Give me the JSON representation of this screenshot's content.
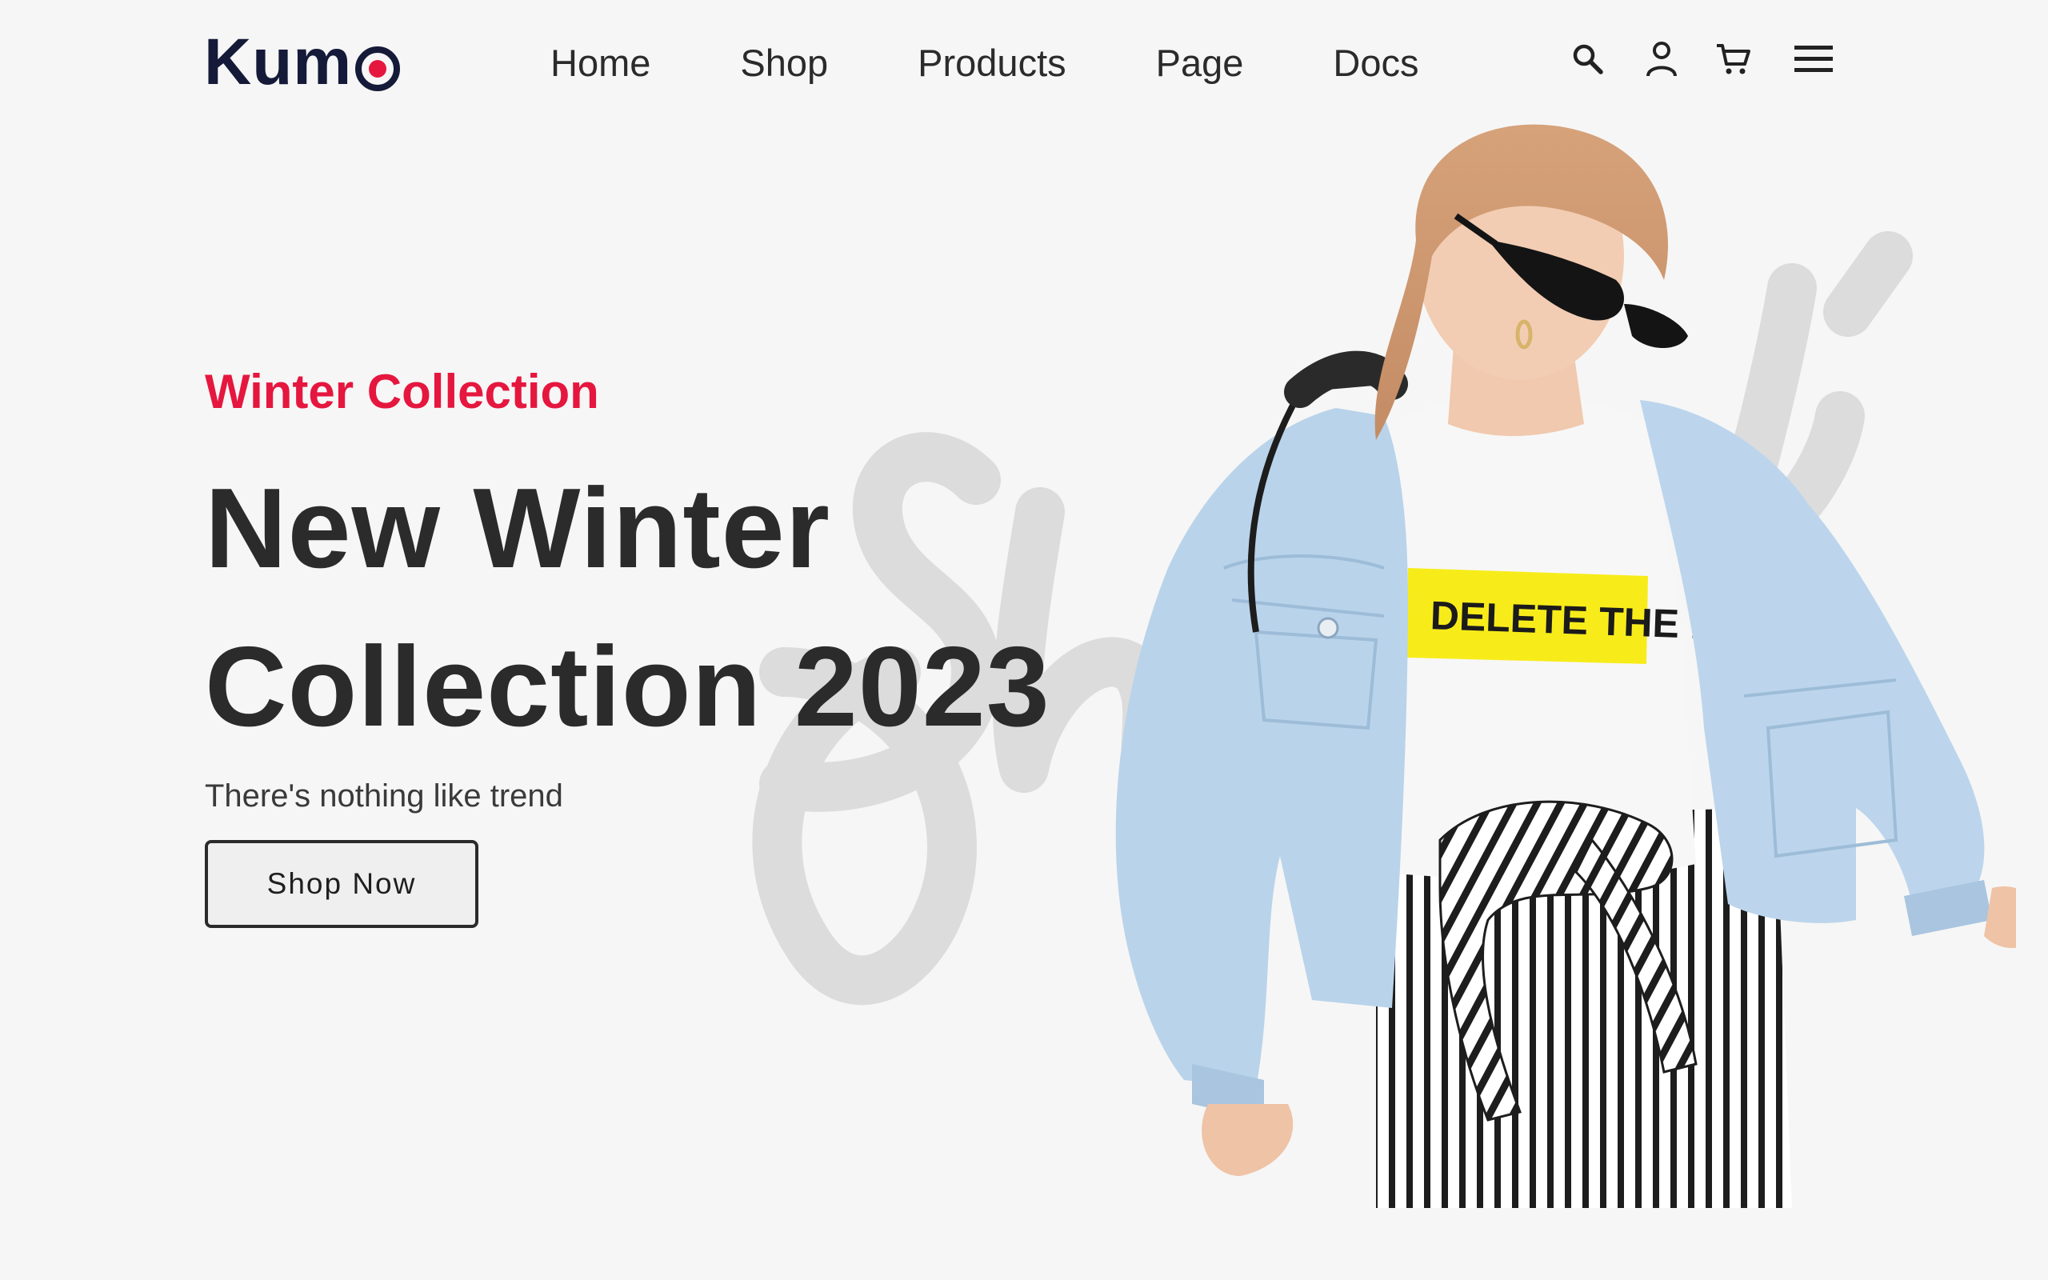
{
  "brand": {
    "logo_text": "Kum",
    "accent_color": "#e5173f",
    "dark_color": "#141a38"
  },
  "nav": {
    "items": [
      {
        "label": "Home"
      },
      {
        "label": "Shop"
      },
      {
        "label": "Products"
      },
      {
        "label": "Page"
      },
      {
        "label": "Docs"
      }
    ]
  },
  "header_icons": [
    "search-icon",
    "user-icon",
    "cart-icon",
    "menu-icon"
  ],
  "hero": {
    "eyebrow": "Winter Collection",
    "headline_line1": "New Winter",
    "headline_line2": "Collection 2023",
    "subtitle": "There's nothing like trend",
    "cta_label": "Shop Now",
    "tshirt_print": "DELETE THE DRAMA"
  }
}
